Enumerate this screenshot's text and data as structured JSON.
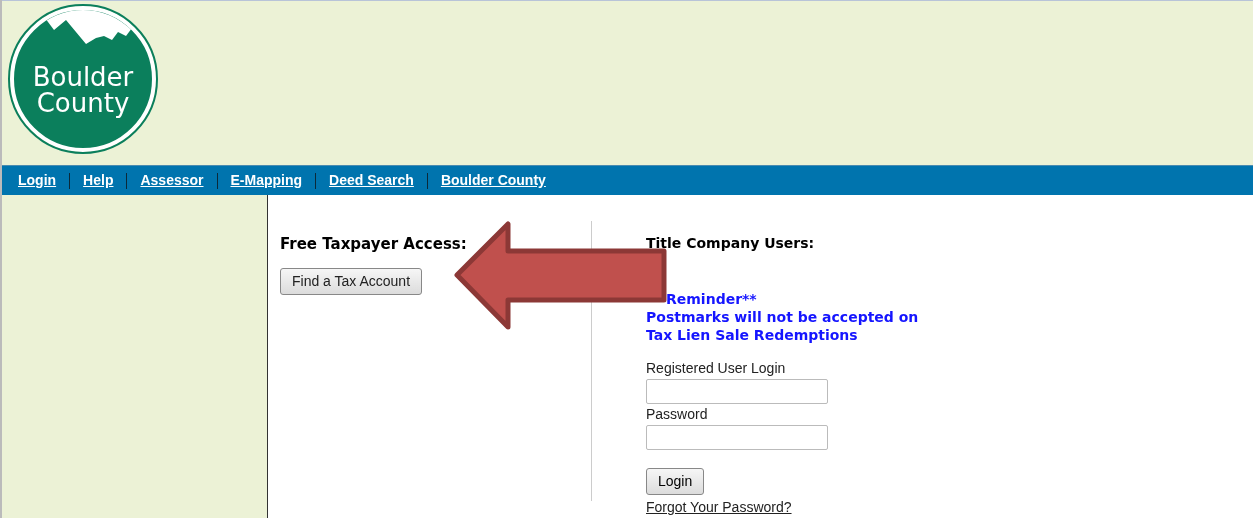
{
  "logo": {
    "lines": [
      "Boulder",
      "County"
    ]
  },
  "nav": [
    {
      "label": "Login"
    },
    {
      "label": "Help"
    },
    {
      "label": "Assessor"
    },
    {
      "label": "E-Mapping"
    },
    {
      "label": "Deed Search"
    },
    {
      "label": "Boulder County"
    }
  ],
  "taxpayer": {
    "heading": "Free Taxpayer Access:",
    "button": "Find a Tax Account"
  },
  "title_company": {
    "heading": "Title Company Users:",
    "notice": [
      "Reminder**",
      "Postmarks will not be accepted on",
      "Tax Lien Sale Redemptions"
    ],
    "fields": [
      {
        "label": "Registered User Login"
      },
      {
        "label": "Password"
      }
    ],
    "button": "Login",
    "link": "Forgot Your Password?"
  }
}
